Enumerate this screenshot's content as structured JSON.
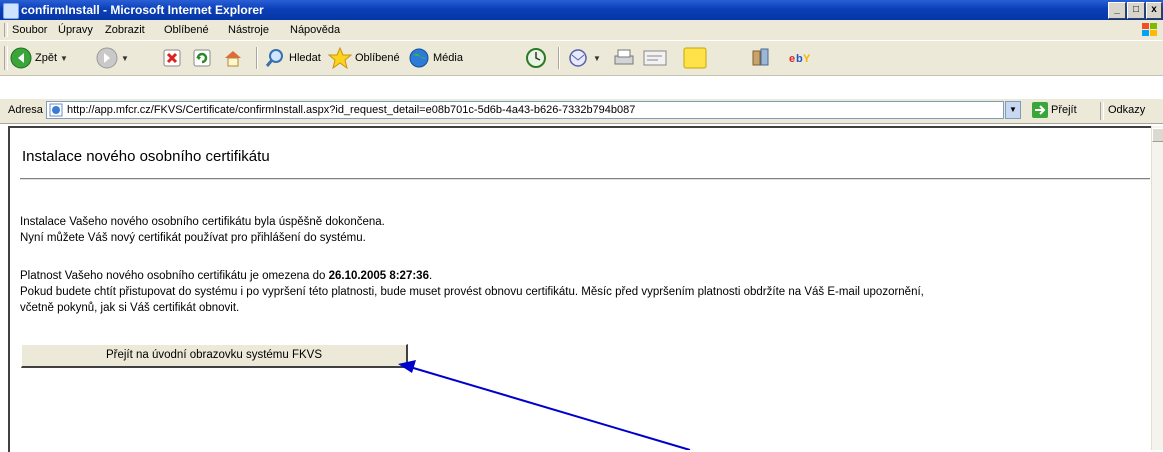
{
  "window": {
    "title": "confirmInstall - Microsoft Internet Explorer",
    "minimize": "_",
    "maximize": "□",
    "close": "x"
  },
  "menu": {
    "items": [
      "Soubor",
      "Úpravy",
      "Zobrazit",
      "Oblíbené",
      "Nástroje",
      "Nápověda"
    ]
  },
  "toolbar": {
    "back_label": "Zpět",
    "search_label": "Hledat",
    "favorites_label": "Oblíbené",
    "media_label": "Média"
  },
  "address": {
    "label": "Adresa",
    "url": "http://app.mfcr.cz/FKVS/Certificate/confirmInstall.aspx?id_request_detail=e08b701c-5d6b-4a43-b626-7332b794b087",
    "go_label": "Přejít",
    "links_label": "Odkazy"
  },
  "page": {
    "title": "Instalace nového osobního certifikátu",
    "line1": "Instalace Vašeho nového osobního certifikátu byla úspěšně dokončena.",
    "line2": "Nyní můžete Váš nový certifikát používat pro přihlášení do systému.",
    "validity_prefix": "Platnost Vašeho nového osobního certifikátu je omezena do ",
    "validity_date": "26.10.2005 8:27:36",
    "validity_suffix": ".",
    "line4": "Pokud budete chtít přistupovat do systému i po vypršení této platnosti, bude muset provést obnovu certifikátu. Měsíc před vypršením platnosti obdržíte na Váš E-mail upozornění,",
    "line5": "včetně pokynů, jak si Váš certifikát obnovit.",
    "button_label": "Přejít na úvodní obrazovku systému FKVS"
  },
  "colors": {
    "titlebar": "#0a3fb8",
    "chrome": "#ece9d8",
    "arrow": "#0000cc"
  }
}
